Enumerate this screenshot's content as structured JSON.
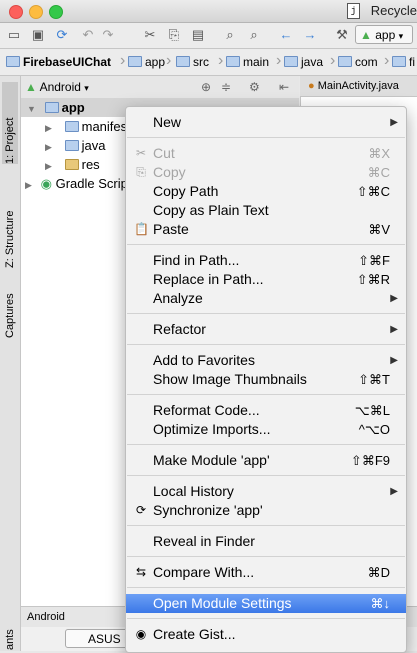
{
  "window": {
    "title": "Recycle",
    "doc_icon": "j"
  },
  "toolbar": {
    "run_config": "app"
  },
  "breadcrumb": [
    "FirebaseUIChat",
    "app",
    "src",
    "main",
    "java",
    "com",
    "fi"
  ],
  "side_tabs": {
    "project": "1: Project",
    "structure": "Z: Structure",
    "captures": "Captures",
    "variants": "ants"
  },
  "panel": {
    "view": "Android",
    "tree": [
      {
        "label": "app",
        "indent": 0,
        "expanded": true
      },
      {
        "label": "manifests",
        "indent": 1
      },
      {
        "label": "java",
        "indent": 1
      },
      {
        "label": "res",
        "indent": 1
      },
      {
        "label": "Gradle Scripts",
        "indent": 0
      }
    ]
  },
  "editor": {
    "tab": "MainActivity.java"
  },
  "bottom": {
    "header": "Android",
    "device": "ASUS Nexus 7"
  },
  "menu": {
    "items": [
      {
        "label": "New",
        "shortcut": "",
        "submenu": true
      },
      {
        "sep": true
      },
      {
        "label": "Cut",
        "shortcut": "⌘X",
        "disabled": true,
        "icon": "✂"
      },
      {
        "label": "Copy",
        "shortcut": "⌘C",
        "disabled": true,
        "icon": "⎘"
      },
      {
        "label": "Copy Path",
        "shortcut": "⇧⌘C"
      },
      {
        "label": "Copy as Plain Text",
        "shortcut": ""
      },
      {
        "label": "Paste",
        "shortcut": "⌘V",
        "icon": "📋"
      },
      {
        "sep": true
      },
      {
        "label": "Find in Path...",
        "shortcut": "⇧⌘F"
      },
      {
        "label": "Replace in Path...",
        "shortcut": "⇧⌘R"
      },
      {
        "label": "Analyze",
        "shortcut": "",
        "submenu": true
      },
      {
        "sep": true
      },
      {
        "label": "Refactor",
        "shortcut": "",
        "submenu": true
      },
      {
        "sep": true
      },
      {
        "label": "Add to Favorites",
        "shortcut": "",
        "submenu": true
      },
      {
        "label": "Show Image Thumbnails",
        "shortcut": "⇧⌘T"
      },
      {
        "sep": true
      },
      {
        "label": "Reformat Code...",
        "shortcut": "⌥⌘L"
      },
      {
        "label": "Optimize Imports...",
        "shortcut": "^⌥O"
      },
      {
        "sep": true
      },
      {
        "label": "Make Module 'app'",
        "shortcut": "⇧⌘F9"
      },
      {
        "sep": true
      },
      {
        "label": "Local History",
        "shortcut": "",
        "submenu": true
      },
      {
        "label": "Synchronize 'app'",
        "shortcut": "",
        "icon": "⟳"
      },
      {
        "sep": true
      },
      {
        "label": "Reveal in Finder",
        "shortcut": ""
      },
      {
        "sep": true
      },
      {
        "label": "Compare With...",
        "shortcut": "⌘D",
        "icon": "⇆"
      },
      {
        "sep": true
      },
      {
        "label": "Open Module Settings",
        "shortcut": "⌘↓",
        "highlighted": true
      },
      {
        "sep": true
      },
      {
        "label": "Create Gist...",
        "shortcut": "",
        "icon": "◉"
      }
    ]
  }
}
